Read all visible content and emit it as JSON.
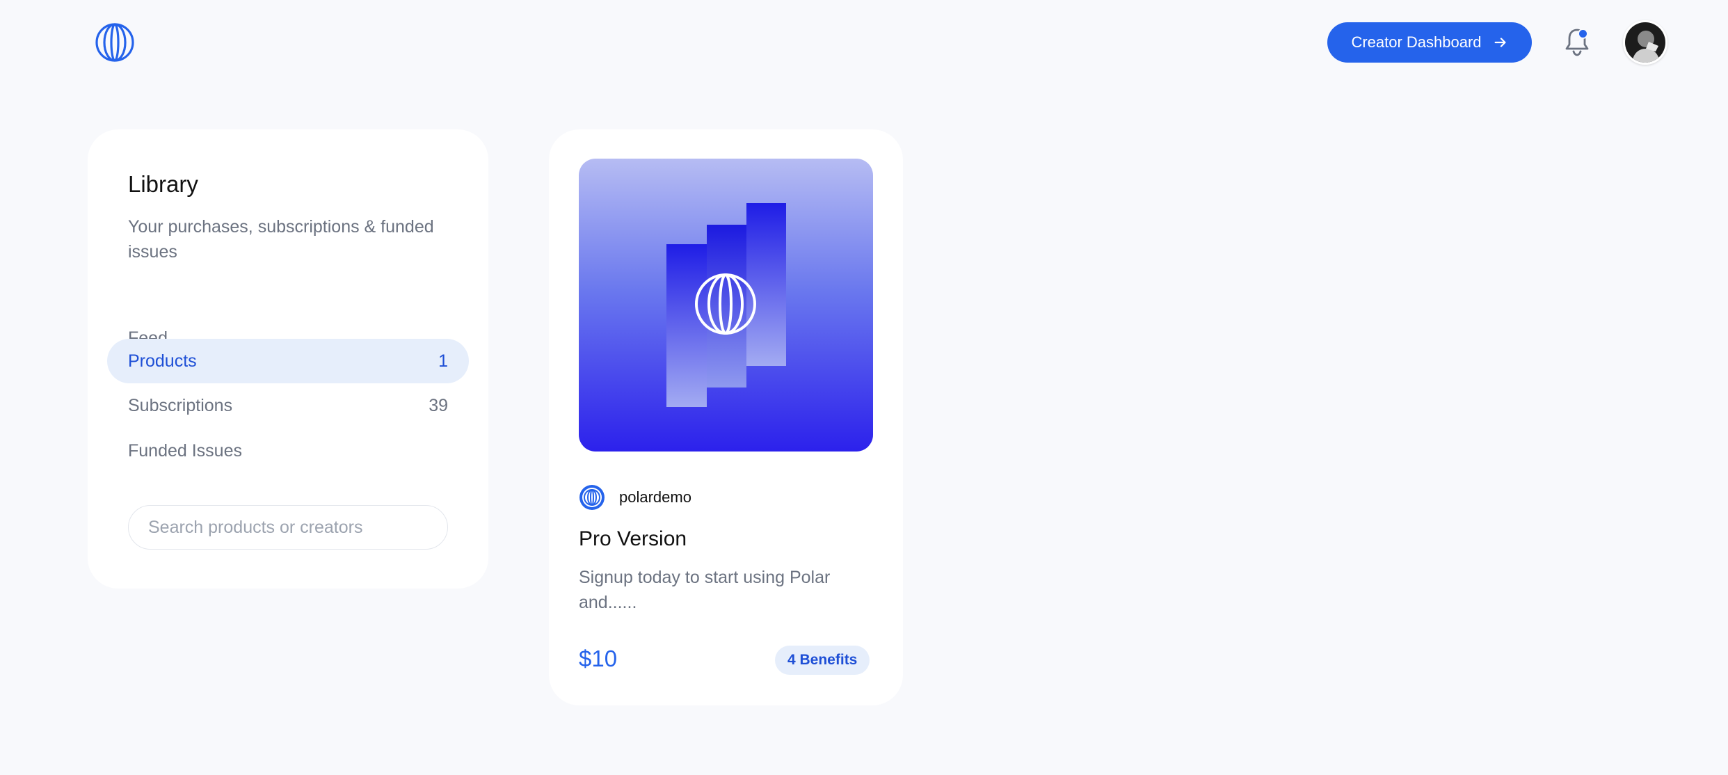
{
  "header": {
    "cta_label": "Creator Dashboard",
    "brand_color": "#2563eb",
    "notification_unread": true
  },
  "sidebar": {
    "title": "Library",
    "subtitle": "Your purchases, subscriptions & funded issues",
    "items": [
      {
        "label": "Feed",
        "count": "",
        "active": false
      },
      {
        "label": "Products",
        "count": "1",
        "active": true
      },
      {
        "label": "Subscriptions",
        "count": "39",
        "active": false
      },
      {
        "label": "Funded Issues",
        "count": "",
        "active": false
      }
    ],
    "search_placeholder": "Search products or creators"
  },
  "products": [
    {
      "org": "polardemo",
      "title": "Pro Version",
      "description": "Signup today to start using Polar and......",
      "price": "$10",
      "benefits": "4 Benefits"
    }
  ],
  "icons": {
    "logo": "polar-logo-icon",
    "cta_arrow": "arrow-right-icon",
    "bell": "bell-icon",
    "org_avatar": "polar-logo-icon"
  }
}
